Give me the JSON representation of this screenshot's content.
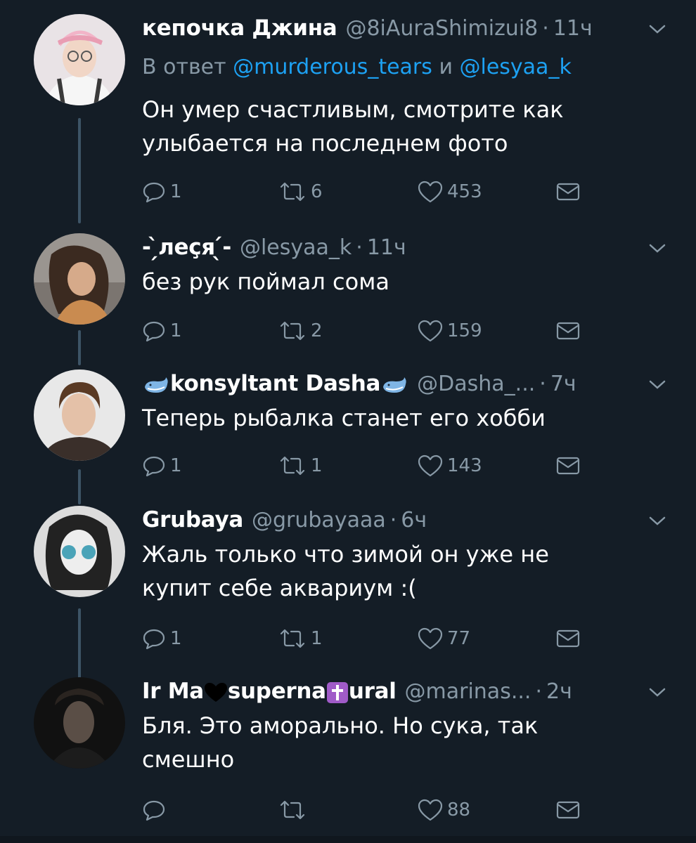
{
  "tweets": [
    {
      "name": "кепочка Джина",
      "handle": "@8iAuraShimizui8",
      "dot": "·",
      "time": "11ч",
      "reply_prefix": "В ответ",
      "reply_mention1": "@murderous_tears",
      "reply_and": "и",
      "reply_mention2": "@lesyaa_k",
      "text": "Он умер счастливым,  смотрите как улыбается на последнем фото",
      "replies": "1",
      "retweets": "6",
      "likes": "453"
    },
    {
      "name_pre": "- ̗̀",
      "name": "леçя",
      "name_post": " ̖́-",
      "handle": "@lesyaa_k",
      "dot": "·",
      "time": "11ч",
      "text": "без рук поймал сома",
      "replies": "1",
      "retweets": "2",
      "likes": "159"
    },
    {
      "name": "konsyltant Dasha",
      "handle": "@Dasha_...",
      "dot": "·",
      "time": "7ч",
      "text": "Теперь рыбалка станет его хобби",
      "replies": "1",
      "retweets": "1",
      "likes": "143"
    },
    {
      "name": "Grubaya",
      "handle": "@grubayaaa",
      "dot": "·",
      "time": "6ч",
      "text": "Жаль только что зимой он уже не купит себе аквариум :(",
      "replies": "1",
      "retweets": "1",
      "likes": "77"
    },
    {
      "name_a": "Ir Ma",
      "name_b": "superna",
      "name_c": "ural",
      "handle": "@marinas...",
      "dot": "·",
      "time": "2ч",
      "text": "Бля. Это аморально. Но сука, так смешно",
      "likes": "88"
    }
  ],
  "icons": [
    "reply-icon",
    "retweet-icon",
    "like-icon",
    "dm-icon",
    "chevron-down-icon",
    "whale-emoji-icon",
    "black-heart-emoji-icon",
    "cross-emoji-icon"
  ],
  "colors": {
    "background": "#141d26",
    "secondary_text": "#8899a6",
    "link": "#1da1f2",
    "thread_line": "#3d5466"
  }
}
